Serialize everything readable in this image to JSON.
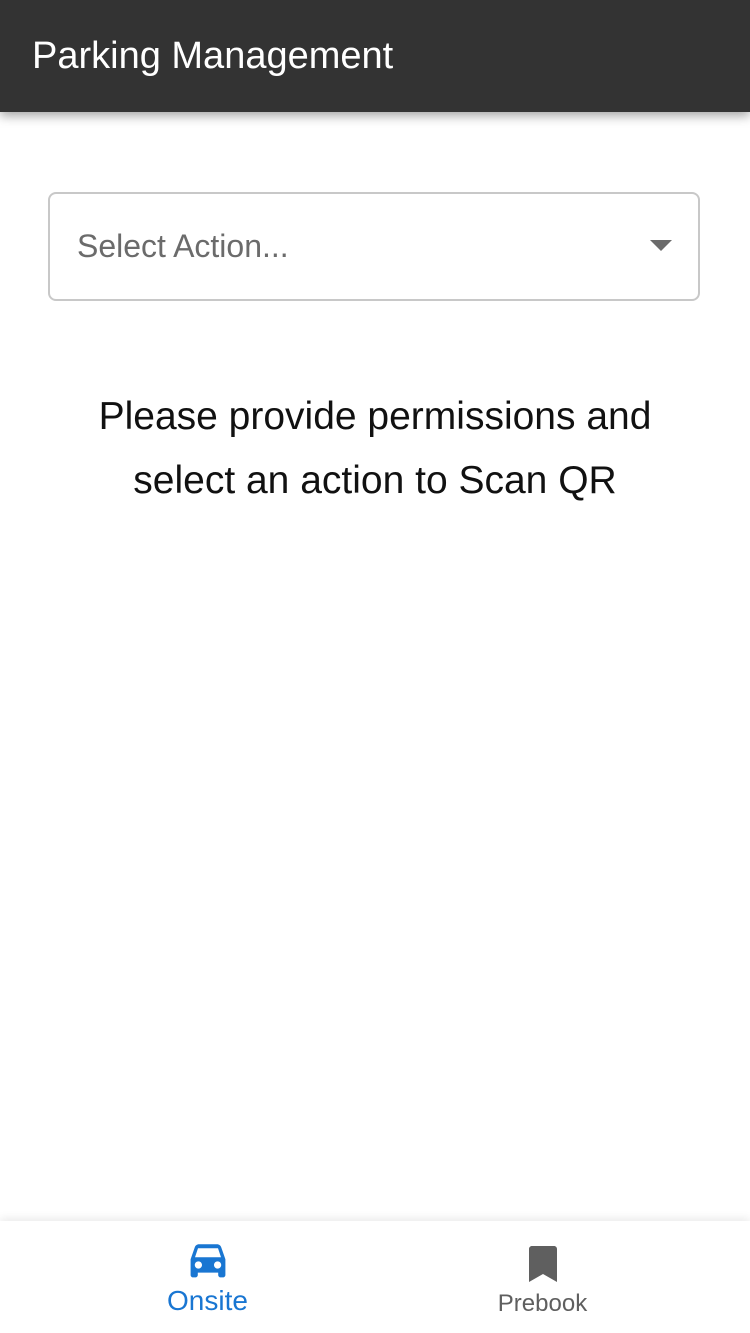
{
  "app_bar": {
    "title": "Parking Management"
  },
  "action_select": {
    "placeholder": "Select Action...",
    "icon": "dropdown-arrow-icon"
  },
  "message": {
    "line1": "Please provide permissions and",
    "line2": "select an action to Scan QR"
  },
  "bottom_nav": {
    "items": [
      {
        "label": "Onsite",
        "icon": "car-icon",
        "active": true,
        "color": "#1976d2"
      },
      {
        "label": "Prebook",
        "icon": "bookmark-icon",
        "active": false,
        "color": "#5f5f5f"
      }
    ]
  },
  "colors": {
    "app_bar": "#333333",
    "accent": "#1976d2",
    "inactive": "#5f5f5f"
  }
}
